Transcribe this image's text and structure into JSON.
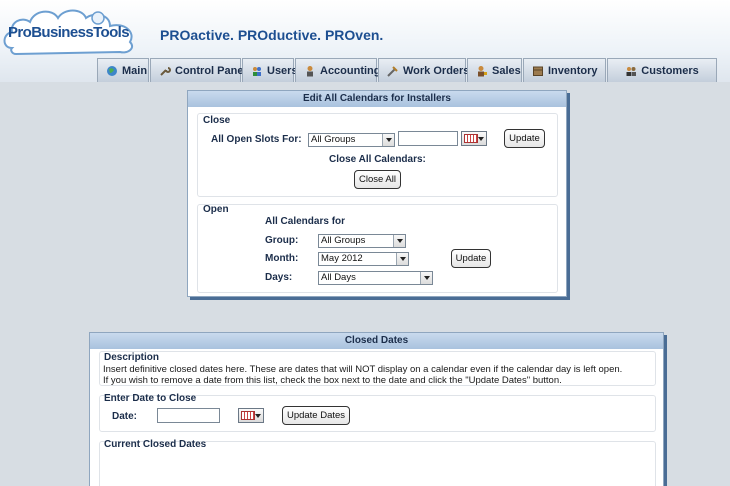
{
  "header": {
    "logo_text": "ProBusinessTools",
    "tagline": "PROactive. PROductive. PROven."
  },
  "nav": [
    {
      "label": "Main",
      "icon": "globe-icon"
    },
    {
      "label": "Control Panel",
      "icon": "wrench-icon"
    },
    {
      "label": "Users",
      "icon": "users-icon"
    },
    {
      "label": "Accounting",
      "icon": "accountant-icon"
    },
    {
      "label": "Work Orders",
      "icon": "tools-icon"
    },
    {
      "label": "Sales",
      "icon": "salesperson-icon"
    },
    {
      "label": "Inventory",
      "icon": "box-icon"
    },
    {
      "label": "Customers",
      "icon": "customers-icon"
    }
  ],
  "edit_panel": {
    "title": "Edit All Calendars for Installers",
    "close": {
      "heading": "Close",
      "open_slots_label": "All Open Slots For:",
      "group_value": "All Groups",
      "date_value": "",
      "update_label": "Update",
      "close_all_label": "Close All Calendars:",
      "close_all_button": "Close All"
    },
    "open": {
      "heading": "Open",
      "all_calendars_label": "All Calendars for",
      "group_label": "Group:",
      "group_value": "All Groups",
      "month_label": "Month:",
      "month_value": "May 2012",
      "days_label": "Days:",
      "days_value": "All Days",
      "update_label": "Update"
    }
  },
  "closed_panel": {
    "title": "Closed Dates",
    "description_heading": "Description",
    "description_line1": "Insert definitive closed dates here. These are dates that will NOT display on a calendar even if the calendar day is left open.",
    "description_line2": "If you wish to remove a date from this list, check the box next to the date and click the \"Update Dates\" button.",
    "enter_heading": "Enter Date to Close",
    "date_label": "Date:",
    "date_value": "",
    "update_dates_label": "Update Dates",
    "current_heading": "Current Closed Dates"
  },
  "colors": {
    "brand": "#1d4f91",
    "background": "#d7dde3",
    "panel_shadow": "#4a6d95"
  }
}
